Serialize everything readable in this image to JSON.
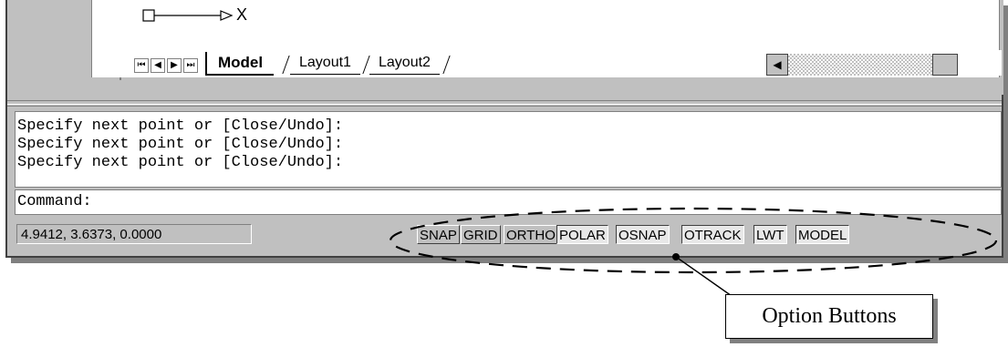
{
  "ucs_icon": {
    "axis_label": "X"
  },
  "tabs": {
    "nav_buttons": [
      "⏮",
      "◀",
      "▶",
      "⏭"
    ],
    "items": [
      "Model",
      "Layout1",
      "Layout2"
    ],
    "active": "Model"
  },
  "scrollbar": {
    "left_arrow": "◀"
  },
  "command_history": [
    "Specify next point or [Close/Undo]:",
    "Specify next point or [Close/Undo]:",
    "Specify next point or [Close/Undo]:"
  ],
  "command_line": "Command:",
  "status": {
    "coordinates": "4.9412, 3.6373, 0.0000",
    "buttons": [
      "SNAP",
      "GRID",
      "ORTHO",
      "POLAR",
      "OSNAP",
      "OTRACK",
      "LWT",
      "MODEL"
    ],
    "pressed": [
      "POLAR",
      "OSNAP",
      "OTRACK",
      "LWT",
      "MODEL"
    ]
  },
  "annotation": {
    "callout_text": "Option Buttons"
  }
}
